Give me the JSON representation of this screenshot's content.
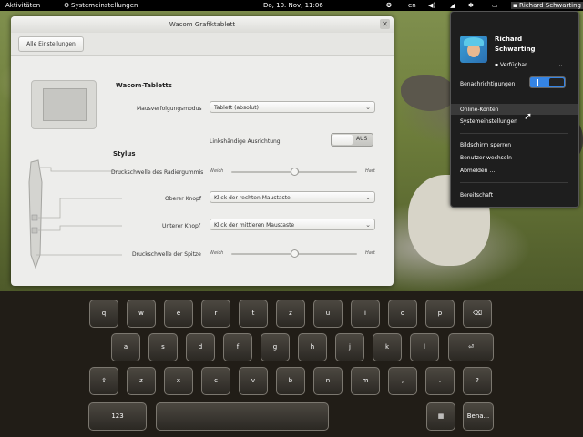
{
  "topbar": {
    "activities": "Aktivitäten",
    "app_menu": "Systemeinstellungen",
    "clock": "Do, 10. Nov, 11:06",
    "keyboard_layout": "en",
    "user_name": "Richard Schwarting"
  },
  "window": {
    "title": "Wacom Grafiktablett",
    "all_settings_button": "Alle Einstellungen",
    "tablet_section": "Wacom-Tabletts",
    "tracking_mode_label": "Mausverfolgungsmodus",
    "tracking_mode_value": "Tablett (absolut)",
    "left_handed_label": "Linkshändige Ausrichtung:",
    "left_handed_switch_off": "AUS",
    "stylus_section": "Stylus",
    "eraser_label": "Druckschwelle des Radiergummis",
    "eraser_soft": "Weich",
    "eraser_hard": "Hart",
    "eraser_level": 0.5,
    "upper_button_label": "Oberer Knopf",
    "upper_button_value": "Klick der rechten Maustaste",
    "lower_button_label": "Unterer Knopf",
    "lower_button_value": "Klick der mittleren Maustaste",
    "tip_label": "Druckschwelle der Spitze",
    "tip_soft": "Weich",
    "tip_hard": "Hart",
    "tip_level": 0.5
  },
  "user_menu": {
    "name_line1": "Richard",
    "name_line2": "Schwarting",
    "status": "Verfügbar",
    "notifications_label": "Benachrichtigungen",
    "notifications_state": "on",
    "online_accounts": "Online-Konten",
    "system_settings": "Systemeinstellungen",
    "lock_screen": "Bildschirm sperren",
    "switch_user": "Benutzer wechseln",
    "log_out": "Abmelden …",
    "suspend": "Bereitschaft"
  },
  "keyboard": {
    "row1": [
      "q",
      "w",
      "e",
      "r",
      "t",
      "z",
      "u",
      "i",
      "o",
      "p",
      "⌫"
    ],
    "row2": [
      "a",
      "s",
      "d",
      "f",
      "g",
      "h",
      "j",
      "k",
      "l",
      "⏎"
    ],
    "row3": [
      "⇧",
      "z",
      "x",
      "c",
      "v",
      "b",
      "n",
      "m",
      ",",
      ".",
      "?"
    ],
    "numbers_key": "123",
    "layout_key": "▦",
    "hide_key": "Bena..."
  }
}
